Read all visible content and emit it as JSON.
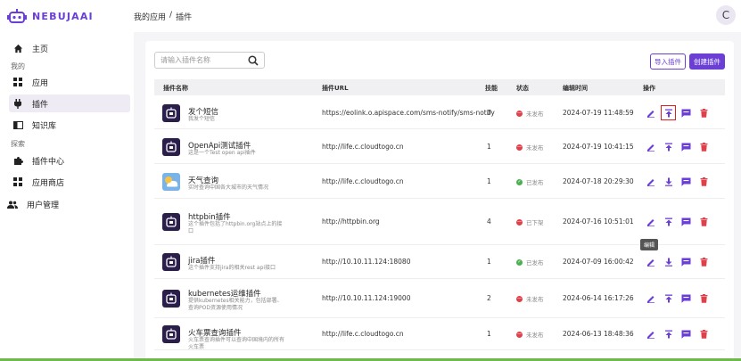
{
  "app": {
    "brand": "NEBUJAAI",
    "avatar_letter": "C"
  },
  "breadcrumb": [
    "我的应用",
    "/",
    "插件"
  ],
  "sidebar": {
    "items": [
      {
        "label": "主页",
        "icon": "home-icon"
      },
      {
        "section": "我的"
      },
      {
        "label": "应用",
        "icon": "grid-icon"
      },
      {
        "label": "插件",
        "icon": "plug-icon",
        "active": true
      },
      {
        "label": "知识库",
        "icon": "book-icon"
      },
      {
        "section": "探索"
      },
      {
        "label": "插件中心",
        "icon": "puzzle-icon"
      },
      {
        "label": "应用商店",
        "icon": "grid-icon"
      },
      {
        "label": "用户管理",
        "icon": "users-icon"
      }
    ]
  },
  "toolbar": {
    "search_placeholder": "请输入插件名称",
    "import_label": "导入插件",
    "create_label": "创建插件"
  },
  "table": {
    "headers": [
      "插件名称",
      "插件URL",
      "技能",
      "状态",
      "编辑时间",
      "操作"
    ],
    "rows": [
      {
        "name": "发个短信",
        "desc": "我发个短信",
        "url": "https://eolink.o.apispace.com/sms-notify/sms-notify",
        "skills": "0",
        "status": "未发布",
        "status_type": "unpublished",
        "time": "2024-07-19 11:48:59",
        "icon": "plugin-logo-icon"
      },
      {
        "name": "OpenApi测试插件",
        "desc": "这是一个Test open api插件",
        "url": "http://life.c.cloudtogo.cn",
        "skills": "1",
        "status": "未发布",
        "status_type": "unpublished",
        "time": "2024-07-19 10:41:15",
        "icon": "plugin-logo-icon"
      },
      {
        "name": "天气查询",
        "desc": "实时查询中国各大城市的天气情况",
        "url": "http://life.c.cloudtogo.cn",
        "skills": "1",
        "status": "已发布",
        "status_type": "published",
        "time": "2024-07-18 20:29:30",
        "icon": "weather-icon"
      },
      {
        "name": "httpbin插件",
        "desc": "这个插件包括了httpbin.org站点上的接口",
        "url": "http://httpbin.org",
        "skills": "4",
        "status": "已下架",
        "status_type": "removed",
        "time": "2024-07-16 10:51:01",
        "icon": "plugin-logo-icon"
      },
      {
        "name": "jira插件",
        "desc": "这个插件支持jira的相关rest api接口",
        "url": "http://10.10.11.124:18080",
        "skills": "1",
        "status": "已发布",
        "status_type": "published",
        "time": "2024-07-09 16:00:42",
        "icon": "plugin-logo-icon"
      },
      {
        "name": "kubernetes运维插件",
        "desc": "提供kubernetes相关能力，包括部署、查询POD资源使用情况",
        "url": "http://10.10.11.124:19000",
        "skills": "2",
        "status": "未发布",
        "status_type": "unpublished",
        "time": "2024-06-14 16:17:26",
        "icon": "plugin-logo-icon"
      },
      {
        "name": "火车票查询插件",
        "desc": "火车票查询插件可以查询中国境内的所有火车票",
        "url": "http://life.c.cloudtogo.cn",
        "skills": "1",
        "status": "未发布",
        "status_type": "unpublished",
        "time": "2024-06-13 18:48:36",
        "icon": "plugin-logo-icon"
      }
    ]
  },
  "tooltip": "编辑",
  "colors": {
    "accent": "#6b3fd6",
    "unpublished": "#e0404a",
    "published": "#4caf50",
    "removed": "#e0404a",
    "delete": "#e0404a"
  }
}
